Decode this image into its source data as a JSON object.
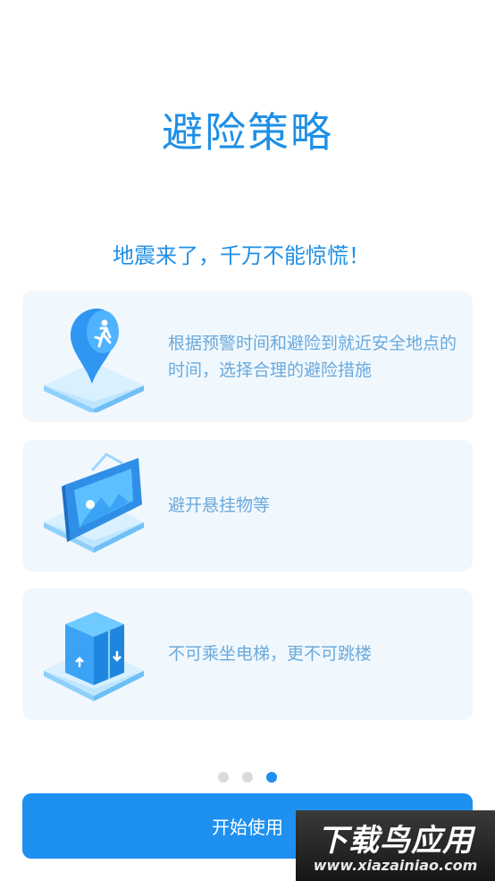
{
  "header": {
    "title": "避险策略"
  },
  "subtitle": "地震来了，千万不能惊慌！",
  "cards": [
    {
      "text": "根据预警时间和避险到就近安全地点的时间，选择合理的避险措施",
      "icon": "location-runner-icon"
    },
    {
      "text": "避开悬挂物等",
      "icon": "hanging-picture-icon"
    },
    {
      "text": "不可乘坐电梯，更不可跳楼",
      "icon": "elevator-icon"
    }
  ],
  "pager": {
    "current": 3,
    "total": 3
  },
  "start_button": {
    "label": "开始使用"
  },
  "watermark": {
    "main": "下载鸟应用",
    "url": "www.xiazainiao.com"
  },
  "colors": {
    "accent": "#1e90f0",
    "card_bg": "#f1f8fd",
    "card_text": "#6aa9dc"
  }
}
